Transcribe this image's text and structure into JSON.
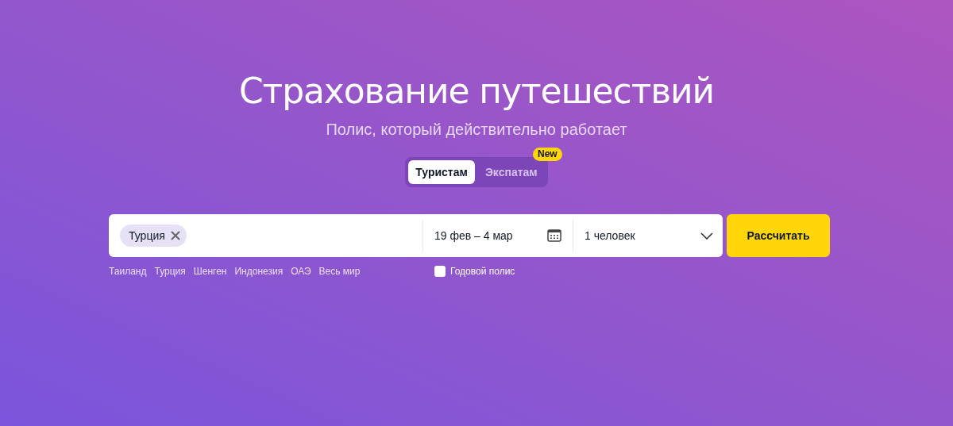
{
  "title": "Страхование путешествий",
  "subtitle": "Полис, который действительно работает",
  "tabs": [
    {
      "label": "Туристам",
      "selected": true
    },
    {
      "label": "Экспатам",
      "selected": false,
      "badge": "New"
    }
  ],
  "destination": {
    "chips": [
      "Турция"
    ]
  },
  "suggestions": [
    "Таиланд",
    "Турция",
    "Шенген",
    "Индонезия",
    "ОАЭ",
    "Весь мир"
  ],
  "dates": {
    "value": "19 фев – 4 мар"
  },
  "travelers": {
    "value": "1 человек"
  },
  "annual_policy": {
    "label": "Годовой полис",
    "checked": false
  },
  "submit": "Рассчитать"
}
